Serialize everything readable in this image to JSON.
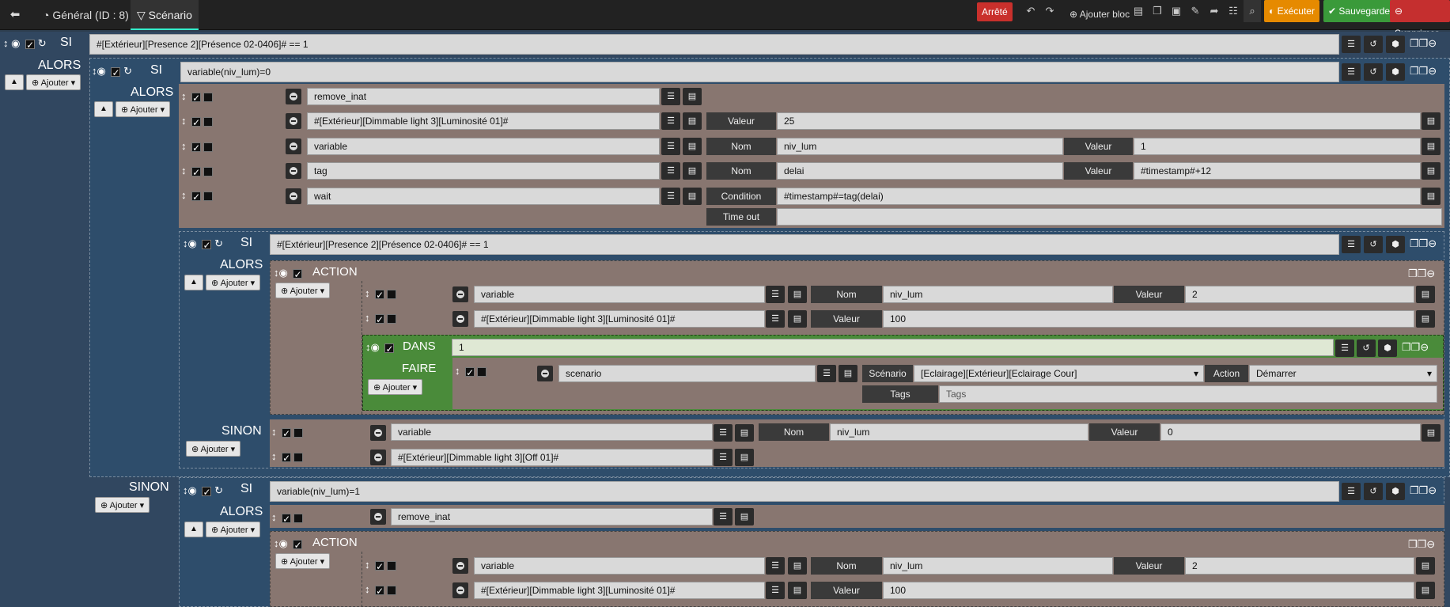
{
  "topbar": {
    "back_icon": "arrow-left-icon",
    "tab_general": "Général (ID : 8)",
    "tab_scenario": "Scénario",
    "status": "Arrêté",
    "add_block": "Ajouter bloc",
    "execute": "Exécuter",
    "save": "Sauvegarder",
    "delete": "Supprimer",
    "colors": {
      "status": "#c9302c",
      "execute": "#e68a00",
      "save": "#3a9a3a",
      "delete": "#c52f2f"
    }
  },
  "labels": {
    "si": "SI",
    "alors": "ALORS",
    "sinon": "SINON",
    "action": "ACTION",
    "dans": "DANS",
    "faire": "FAIRE",
    "ajouter": "Ajouter",
    "valeur": "Valeur",
    "nom": "Nom",
    "condition": "Condition",
    "timeout": "Time out",
    "scenario": "Scénario",
    "action_lbl": "Action",
    "tags": "Tags"
  },
  "b1": {
    "cond": "#[Extérieur][Presence 2][Présence 02-0406]# == 1"
  },
  "b2": {
    "cond": "variable(niv_lum)=0",
    "rows": [
      {
        "cmd": "remove_inat"
      },
      {
        "cmd": "#[Extérieur][Dimmable light 3][Luminosité 01]#",
        "v1": "25"
      },
      {
        "cmd": "variable",
        "n": "niv_lum",
        "v": "1"
      },
      {
        "cmd": "tag",
        "n": "delai",
        "v": "#timestamp#+12"
      },
      {
        "cmd": "wait",
        "cond": "#timestamp#=tag(delai)",
        "timeout": ""
      }
    ]
  },
  "b3": {
    "cond": "#[Extérieur][Presence 2][Présence 02-0406]# == 1",
    "act1": {
      "cmd": "variable",
      "n": "niv_lum",
      "v": "2"
    },
    "act2": {
      "cmd": "#[Extérieur][Dimmable light 3][Luminosité 01]#",
      "v": "100"
    },
    "dans": {
      "val": "1",
      "cmd": "scenario",
      "scen": "[Eclairage][Extérieur][Eclairage Cour]",
      "action": "Démarrer",
      "tags": "Tags"
    },
    "sinon1": {
      "cmd": "variable",
      "n": "niv_lum",
      "v": "0"
    },
    "sinon2": {
      "cmd": "#[Extérieur][Dimmable light 3][Off 01]#"
    }
  },
  "b4": {
    "cond": "variable(niv_lum)=1",
    "r1": {
      "cmd": "remove_inat"
    },
    "act1": {
      "cmd": "variable",
      "n": "niv_lum",
      "v": "2"
    },
    "act2": {
      "cmd": "#[Extérieur][Dimmable light 3][Luminosité 01]#",
      "v": "100"
    }
  }
}
